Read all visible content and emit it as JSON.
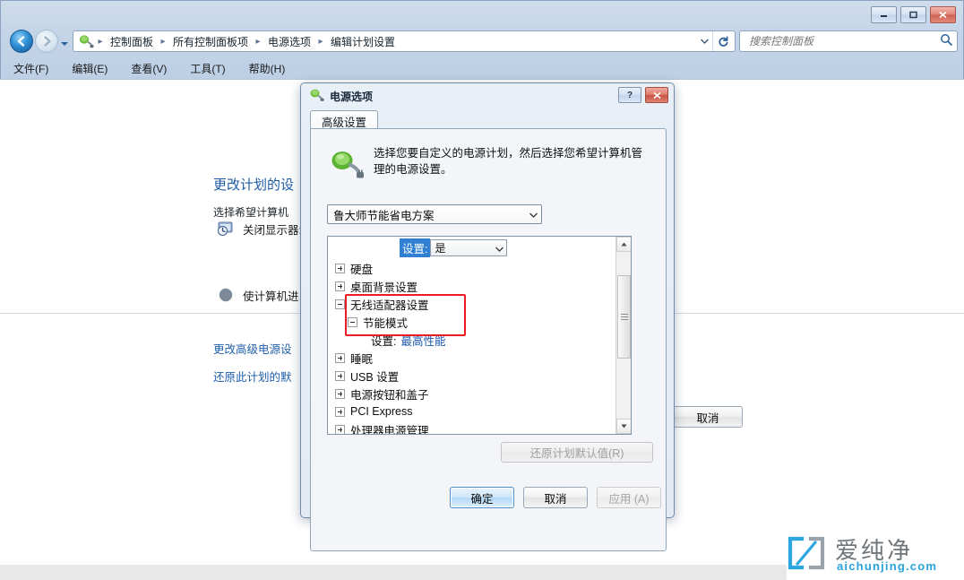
{
  "window": {
    "controls": {
      "minimize": "–",
      "maximize": "□",
      "close": "✕"
    }
  },
  "navigation": {
    "back_title": "后退",
    "forward_title": "前进",
    "history_title": "最近浏览的位置",
    "breadcrumbs": [
      "控制面板",
      "所有控制面板项",
      "电源选项",
      "编辑计划设置"
    ],
    "separator": "▸",
    "dropdown_glyph": "▾",
    "refresh_glyph": "↻"
  },
  "search": {
    "placeholder": "搜索控制面板",
    "value": ""
  },
  "menubar": {
    "items": [
      "文件(F)",
      "编辑(E)",
      "查看(V)",
      "工具(T)",
      "帮助(H)"
    ]
  },
  "page": {
    "title": "更改计划的设",
    "subtitle": "选择希望计算机",
    "options": [
      {
        "label": "关闭显示器:",
        "icon": "display-clock-icon"
      },
      {
        "label": "使计算机进",
        "icon": "sleep-moon-icon"
      }
    ],
    "links": [
      "更改高级电源设",
      "还原此计划的默"
    ],
    "cancel_button": "取消"
  },
  "dialog": {
    "title": "电源选项",
    "help_glyph": "?",
    "close_glyph": "✕",
    "tab": "高级设置",
    "description": "选择您要自定义的电源计划，然后选择您希望计算机管理的电源设置。",
    "plan_combo": {
      "value": "鲁大师节能省电方案",
      "arrow": "▾"
    },
    "inline_editor": {
      "label": "设置:",
      "value": "是",
      "arrow": "▾"
    },
    "tree": [
      {
        "label": "硬盘",
        "level": 0,
        "state": "collapsed"
      },
      {
        "label": "桌面背景设置",
        "level": 0,
        "state": "collapsed"
      },
      {
        "label": "无线适配器设置",
        "level": 0,
        "state": "expanded"
      },
      {
        "label": "节能模式",
        "level": 1,
        "state": "expanded"
      },
      {
        "label": "设置:",
        "value": "最高性能",
        "level": 2,
        "state": "leaf"
      },
      {
        "label": "睡眠",
        "level": 0,
        "state": "collapsed"
      },
      {
        "label": "USB 设置",
        "level": 0,
        "state": "collapsed"
      },
      {
        "label": "电源按钮和盖子",
        "level": 0,
        "state": "collapsed"
      },
      {
        "label": "PCI Express",
        "level": 0,
        "state": "collapsed"
      },
      {
        "label": "处理器电源管理",
        "level": 0,
        "state": "collapsed"
      }
    ],
    "restore_defaults": "还原计划默认值(R)",
    "buttons": {
      "ok": "确定",
      "cancel": "取消",
      "apply": "应用 (A)"
    }
  },
  "watermark": {
    "cn": "爱纯净",
    "en": "aichunjing.com"
  },
  "colors": {
    "accent_blue": "#1f5fab",
    "link_blue": "#1a59ab",
    "highlight": "#2f7fd2",
    "annotation_red": "#ed1c24",
    "watermark_blue": "#29a3dc"
  }
}
